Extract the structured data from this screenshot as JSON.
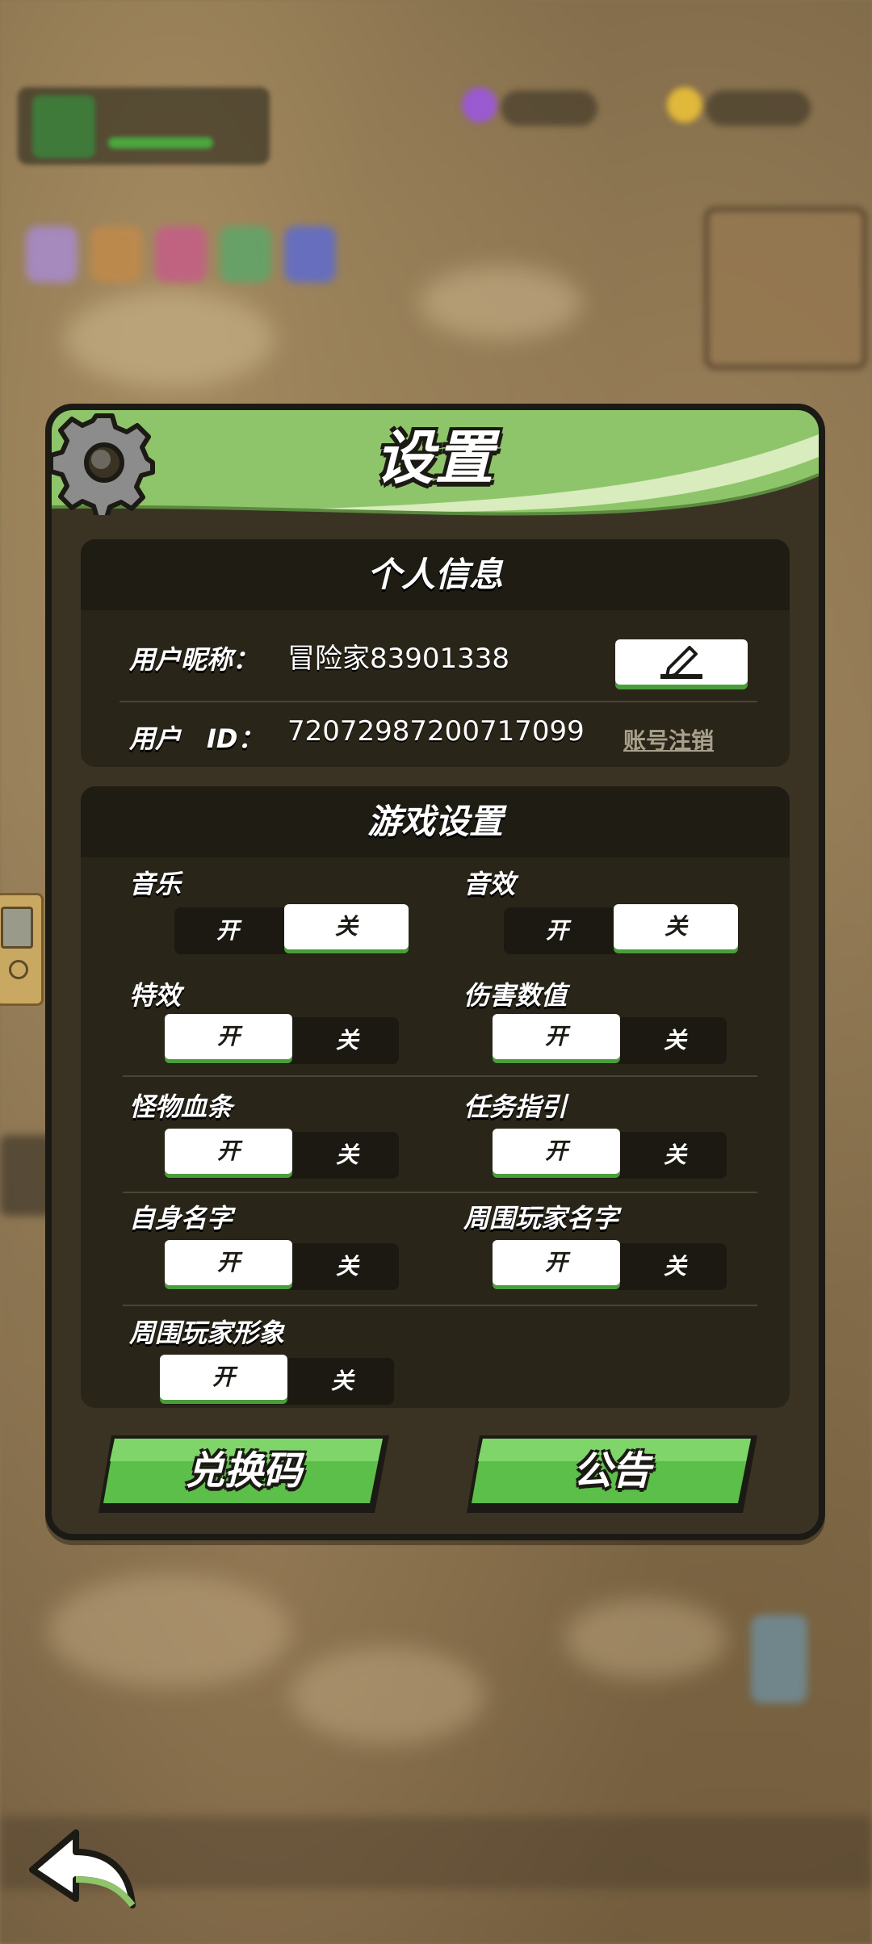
{
  "title": "设置",
  "personal_info": {
    "header": "个人信息",
    "nickname_label": "用户昵称：",
    "nickname_value": "冒险家83901338",
    "id_label": "用户　ID：",
    "id_value": "72072987200717099",
    "cancel_account": "账号注销",
    "edit_icon": "pencil-icon"
  },
  "game_settings": {
    "header": "游戏设置",
    "on_label": "开",
    "off_label": "关",
    "items": [
      {
        "label": "音乐",
        "state": "off"
      },
      {
        "label": "音效",
        "state": "off"
      },
      {
        "label": "特效",
        "state": "on"
      },
      {
        "label": "伤害数值",
        "state": "on"
      },
      {
        "label": "怪物血条",
        "state": "on"
      },
      {
        "label": "任务指引",
        "state": "on"
      },
      {
        "label": "自身名字",
        "state": "on"
      },
      {
        "label": "周围玩家名字",
        "state": "on"
      },
      {
        "label": "周围玩家形象",
        "state": "on"
      }
    ]
  },
  "buttons": {
    "redeem": "兑换码",
    "notice": "公告"
  },
  "colors": {
    "header_green": "#8fc56a",
    "button_green": "#5cbf4a",
    "panel_bg": "#3a3323"
  }
}
